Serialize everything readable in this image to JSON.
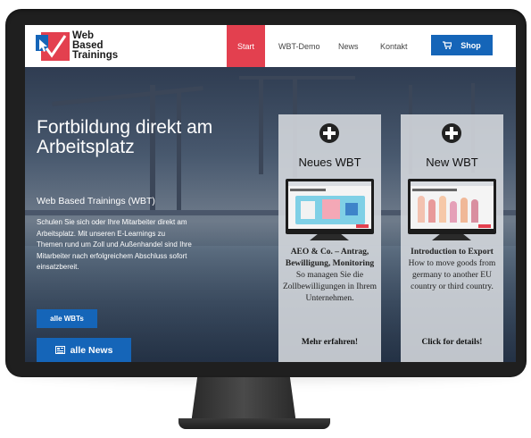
{
  "nav": {
    "logo_line1": "Web",
    "logo_line2": "Based",
    "logo_line3": "Trainings",
    "items": [
      "Start",
      "WBT-Demo",
      "News",
      "Kontakt"
    ],
    "shop_label": "Shop",
    "active_color": "#e3404f",
    "shop_color": "#1565b8"
  },
  "hero": {
    "title": "Fortbildung direkt am Arbeitsplatz",
    "subtitle": "Web Based Trainings (WBT)",
    "text": "Schulen Sie sich oder Ihre Mitarbeiter direkt am Arbeitsplatz. Mit unseren E-Learnings zu Themen rund um Zoll und Außenhandel sind Ihre Mitarbeiter nach erfolgreichem Abschluss sofort einsatzbereit.",
    "btn_wbts": "alle WBTs",
    "btn_news": "alle News"
  },
  "cards": [
    {
      "heading": "Neues WBT",
      "title": "AEO & Co. – Antrag, Bewilligung, Monitoring",
      "desc": "So managen Sie die Zollbewilligungen in Ihrem Unternehmen.",
      "cta": "Mehr erfahren!"
    },
    {
      "heading": "New WBT",
      "title": "Introduction to Export",
      "desc": "How to move goods from germany to another EU country or third country.",
      "cta": "Click for details!"
    }
  ],
  "icons": [
    "logo-icon",
    "cart-icon",
    "plus-circle-icon",
    "news-icon"
  ]
}
